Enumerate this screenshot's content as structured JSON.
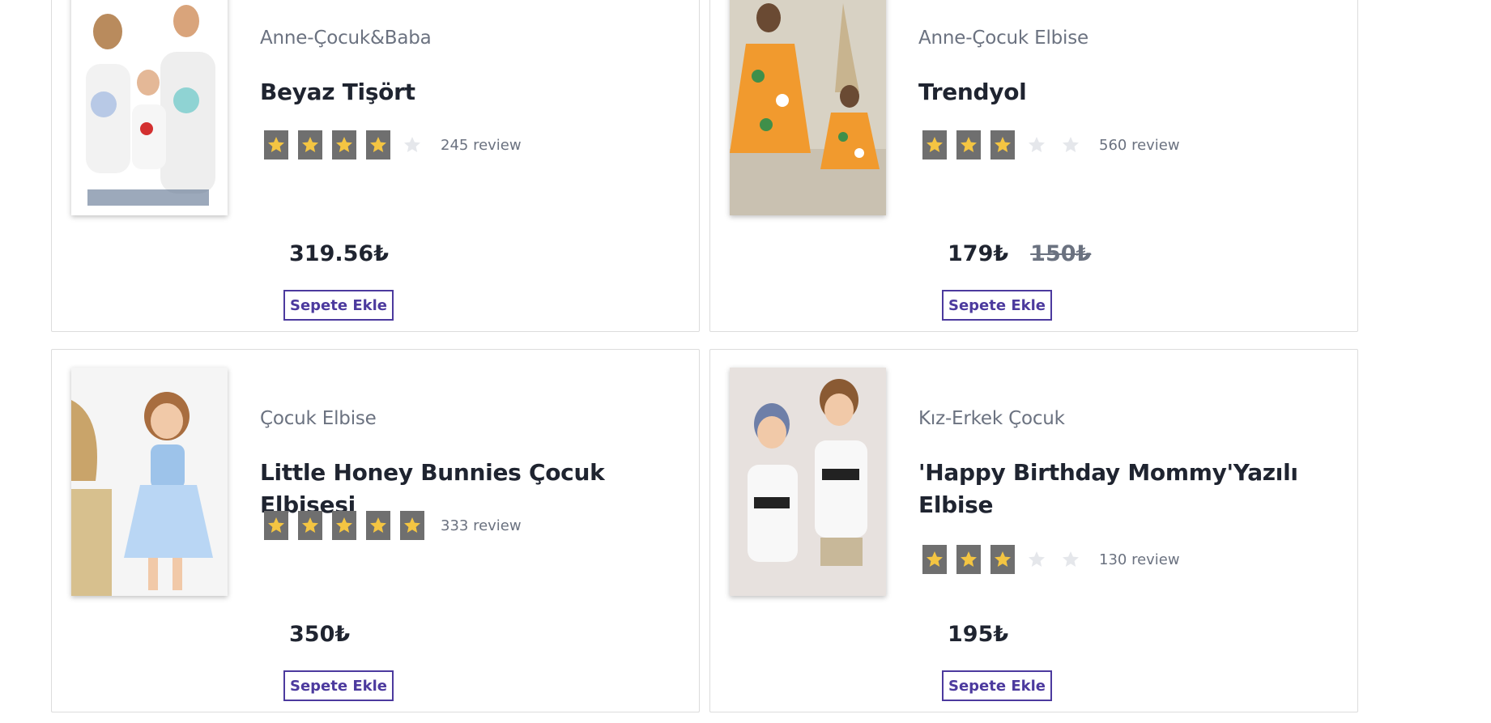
{
  "colors": {
    "accent": "#4c3a9e",
    "star_fill": "#f4c542",
    "star_bg": "#6f6f6f",
    "star_off": "#e5e7eb"
  },
  "icons": {
    "star": "star-icon"
  },
  "products": [
    {
      "category": "Anne-Çocuk&Baba",
      "title": "Beyaz Tişört",
      "rating": 4,
      "reviews": "245 review",
      "price": "319.56₺",
      "old_price": "",
      "button": "Sepete Ekle"
    },
    {
      "category": "Anne-Çocuk Elbise",
      "title": "Trendyol",
      "rating": 3,
      "reviews": "560 review",
      "price": "179₺",
      "old_price": "150₺",
      "button": "Sepete Ekle"
    },
    {
      "category": "Çocuk Elbise",
      "title": "Little Honey Bunnies Çocuk Elbisesi",
      "rating": 5,
      "reviews": "333 review",
      "price": "350₺",
      "old_price": "",
      "button": "Sepete Ekle"
    },
    {
      "category": "Kız-Erkek Çocuk",
      "title": "'Happy Birthday Mommy'Yazılı Elbise",
      "rating": 3,
      "reviews": "130 review",
      "price": "195₺",
      "old_price": "",
      "button": "Sepete Ekle"
    }
  ]
}
